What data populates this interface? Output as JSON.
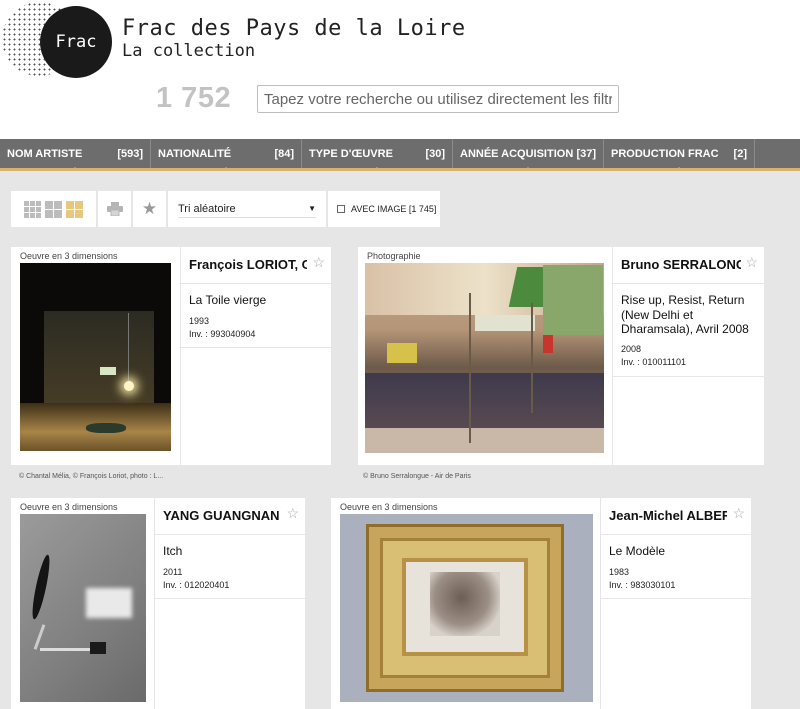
{
  "header": {
    "logo_text": "Frac",
    "title": "Frac des Pays de la Loire",
    "subtitle": "La collection",
    "count": "1 752",
    "search_placeholder": "Tapez votre recherche ou utilisez directement les filtres"
  },
  "filters": [
    {
      "label": "Nom artiste",
      "count": "[593]"
    },
    {
      "label": "Nationalité",
      "count": "[84]"
    },
    {
      "label": "Type d'œuvre",
      "count": "[30]"
    },
    {
      "label": "Année acquisition",
      "count": "[37]"
    },
    {
      "label": "Production Frac",
      "count": "[2]"
    }
  ],
  "toolbar": {
    "sort_value": "Tri aléatoire",
    "image_filter_label": "AVEC IMAGE [1 745]"
  },
  "cards": [
    {
      "type": "Oeuvre en 3 dimensions",
      "artist": "François LORIOT, Ch...",
      "title": "La Toile vierge",
      "year": "1993",
      "inv": "Inv. : 993040904",
      "credit": "© Chantal Mélia, © François Loriot, photo : L..."
    },
    {
      "type": "Photographie",
      "artist": "Bruno SERRALONG...",
      "title": "Rise up, Resist, Return (New Delhi et Dharamsala), Avril 2008",
      "year": "2008",
      "inv": "Inv. : 010011101",
      "credit": "© Bruno Serralongue - Air de Paris"
    },
    {
      "type": "Oeuvre en 3 dimensions",
      "artist": "YANG GUANGNAN",
      "title": "Itch",
      "year": "2011",
      "inv": "Inv. : 012020401",
      "credit": ""
    },
    {
      "type": "Oeuvre en 3 dimensions",
      "artist": "Jean-Michel ALBER...",
      "title": "Le Modèle",
      "year": "1983",
      "inv": "Inv. : 983030101",
      "credit": ""
    }
  ],
  "colors": {
    "accent": "#d7b26b",
    "nav_bg": "#6d6d6d",
    "count_gray": "#c3c3c3"
  }
}
